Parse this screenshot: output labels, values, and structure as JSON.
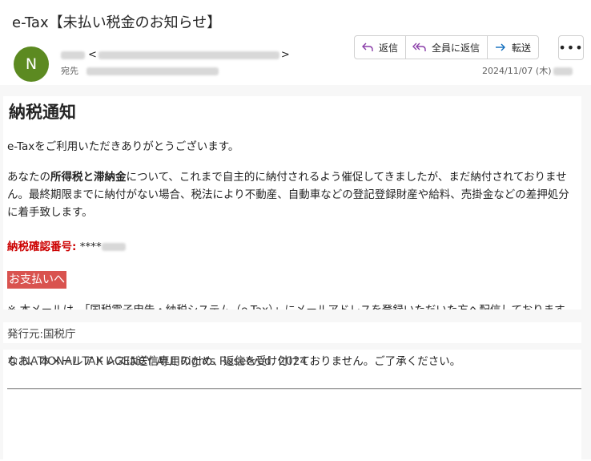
{
  "email": {
    "subject": "e-Tax【未払い税金のお知らせ】",
    "avatar_initial": "N",
    "avatar_color": "#5c8a21",
    "from_bracket_open": "<",
    "from_bracket_close": ">",
    "to_label": "宛先",
    "date": "2024/11/07 (木)"
  },
  "actions": {
    "reply": "返信",
    "reply_all": "全員に返信",
    "forward": "転送",
    "more": "•••"
  },
  "body": {
    "heading": "納税通知",
    "greeting": "e-Taxをご利用いただきありがとうございます。",
    "para1_before": "あなたの",
    "para1_bold": "所得税と滞納金",
    "para1_after": "について、これまで自主的に納付されるよう催促してきましたが、まだ納付されておりません。最終期限までに納付がない場合、税法により不動産、自動車などの登記登録財産や給料、売掛金などの差押処分に着手致します。",
    "confirm_label": "納税確認番号:",
    "confirm_value": "****",
    "pay_button": "お支払いへ",
    "notice1": "※ 本メールは、「国税電子申告・納税システム（e-Tax）」にメールアドレスを登録いただいた方へ配信しております。",
    "notice2": "なお、本メールアドレスは送信専用のため、返信を受け付けておりません。ご了承ください。",
    "issuer": "発行元:国税庁",
    "copyright": "© NATIONAL TAX AGENCY ALL Rights Reserved. 2024"
  },
  "colors": {
    "accent_purple": "#8a3ea8",
    "forward_blue": "#0f6cbd",
    "pay_button_bg": "#d9534f",
    "confirm_red": "#cc0000"
  },
  "icons": [
    "reply-icon",
    "reply-all-icon",
    "forward-icon",
    "more-icon"
  ]
}
